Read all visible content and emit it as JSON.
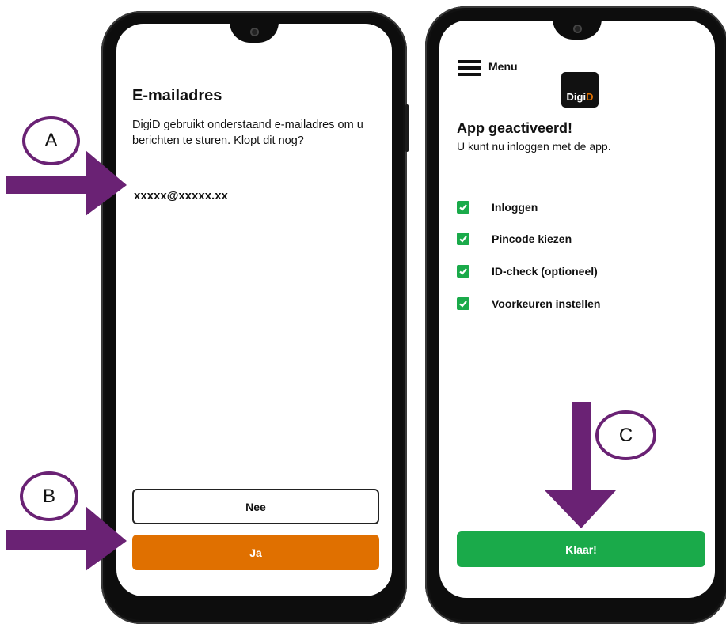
{
  "left_screen": {
    "title": "E-mailadres",
    "body": "DigiD gebruikt onderstaand e-mailadres om u berichten te sturen. Klopt dit nog?",
    "email": "xxxxx@xxxxx.xx",
    "button_no": "Nee",
    "button_yes": "Ja"
  },
  "right_screen": {
    "menu_label": "Menu",
    "logo_text_main": "Digi",
    "logo_text_accent": "D",
    "title": "App geactiveerd!",
    "subtitle": "U kunt nu inloggen met de app.",
    "checklist": [
      {
        "label": "Inloggen",
        "checked": true
      },
      {
        "label": "Pincode kiezen",
        "checked": true
      },
      {
        "label": "ID-check (optioneel)",
        "checked": true
      },
      {
        "label": "Voorkeuren instellen",
        "checked": true
      }
    ],
    "button_done": "Klaar!"
  },
  "annotations": {
    "a": "A",
    "b": "B",
    "c": "C"
  },
  "colors": {
    "orange": "#e07000",
    "green": "#1aaa4a",
    "annotation_purple": "#6a2274"
  }
}
